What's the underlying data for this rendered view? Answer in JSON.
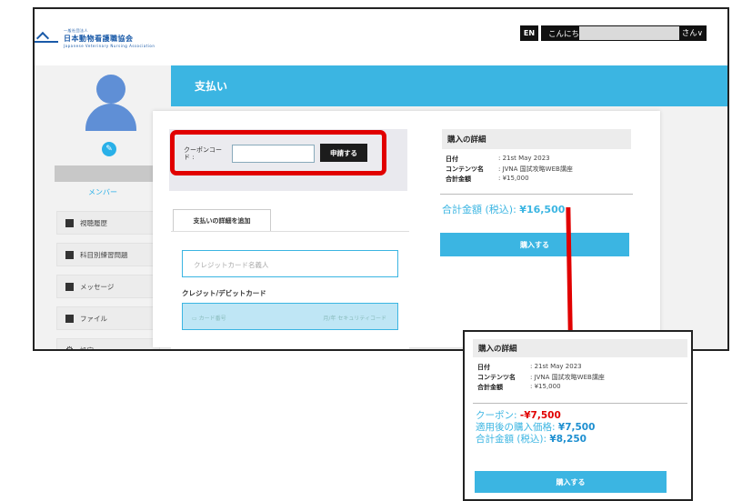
{
  "header": {
    "logo_small": "一般社団法人",
    "logo_name": "日本動物看護職協会",
    "logo_sub": "Japanese Veterinary Nursing Association",
    "lang_button": "EN",
    "greeting": "こんにち",
    "greeting_suffix": "さん"
  },
  "sidebar": {
    "role": "メンバー",
    "items": [
      {
        "label": "視聴履歴",
        "icon": "book-icon"
      },
      {
        "label": "科目別練習問題",
        "icon": "notebook-icon"
      },
      {
        "label": "メッセージ",
        "icon": "message-icon"
      },
      {
        "label": "ファイル",
        "icon": "file-icon"
      },
      {
        "label": "設定",
        "icon": "gear-icon"
      }
    ]
  },
  "main": {
    "title": "支払い",
    "coupon": {
      "label": "クーポンコード",
      "colon": ":",
      "input_value": "",
      "apply_label": "申請する"
    },
    "payment_tab": "支払いの詳細を追加",
    "card_name_placeholder": "クレジットカード名義人",
    "card_label": "クレジット/デビットカード",
    "card_number_placeholder": "カード番号",
    "card_expiry_cvc": "月/年 セキュリティコード"
  },
  "purchase": {
    "title": "購入の詳細",
    "rows": [
      {
        "key": "日付",
        "value": ": 21st May 2023"
      },
      {
        "key": "コンテンツ名",
        "value": ": JVNA 国試攻略WEB講座"
      },
      {
        "key": "合計金額",
        "value": ": ¥15,000"
      }
    ],
    "total_label": "合計金額 (税込):",
    "total_value": "¥16,500",
    "button": "購入する"
  },
  "popup": {
    "title": "購入の詳細",
    "rows": [
      {
        "key": "日付",
        "value": ": 21st May 2023"
      },
      {
        "key": "コンテンツ名",
        "value": ": JVNA 国試攻略WEB講座"
      },
      {
        "key": "合計金額",
        "value": ": ¥15,000"
      }
    ],
    "coupon_label": "クーポン:",
    "coupon_value": "-¥7,500",
    "after_label": "適用後の購入価格:",
    "after_value": "¥7,500",
    "total_label": "合計金額 (税込):",
    "total_value": "¥8,250",
    "button": "購入する"
  },
  "colors": {
    "accent": "#3bb5e2",
    "highlight": "#e10000"
  }
}
